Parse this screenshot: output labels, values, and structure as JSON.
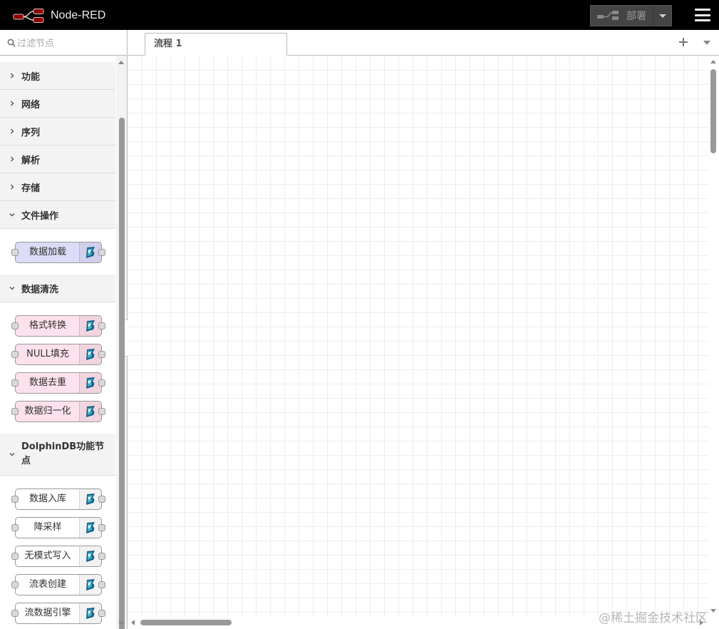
{
  "header": {
    "title": "Node-RED",
    "deploy_label": "部署"
  },
  "palette": {
    "filter_placeholder": "过滤节点",
    "categories": [
      {
        "label": "功能",
        "expanded": false
      },
      {
        "label": "网络",
        "expanded": false
      },
      {
        "label": "序列",
        "expanded": false
      },
      {
        "label": "解析",
        "expanded": false
      },
      {
        "label": "存储",
        "expanded": false
      },
      {
        "label": "文件操作",
        "expanded": true,
        "nodes": [
          {
            "label": "数据加载",
            "color": "#dcdcf8"
          }
        ]
      },
      {
        "label": "数据清洗",
        "expanded": true,
        "nodes": [
          {
            "label": "格式转换",
            "color": "#fde1ec"
          },
          {
            "label": "NULL填充",
            "color": "#fde1ec"
          },
          {
            "label": "数据去重",
            "color": "#fde1ec"
          },
          {
            "label": "数据归一化",
            "color": "#fde1ec"
          }
        ]
      },
      {
        "label": "DolphinDB功能节点",
        "expanded": true,
        "nodes": [
          {
            "label": "数据入库",
            "color": "#ffffff"
          },
          {
            "label": "降采样",
            "color": "#ffffff"
          },
          {
            "label": "无模式写入",
            "color": "#ffffff"
          },
          {
            "label": "流表创建",
            "color": "#ffffff"
          },
          {
            "label": "流数据引擎",
            "color": "#ffffff"
          }
        ]
      }
    ]
  },
  "workspace": {
    "tabs": [
      {
        "label": "流程 1",
        "active": true
      }
    ]
  },
  "watermark": "@稀土掘金技术社区",
  "icons": {
    "logo": "node-red-logo-icon",
    "deploy": "deploy-icon",
    "menu": "hamburger-menu-icon",
    "filter": "search-icon",
    "node": "dolphindb-icon"
  },
  "colors": {
    "header_bg": "#000000",
    "deploy_bg": "#444444",
    "palette_bg": "#f3f3f3",
    "grid_line": "#eeeeee"
  }
}
